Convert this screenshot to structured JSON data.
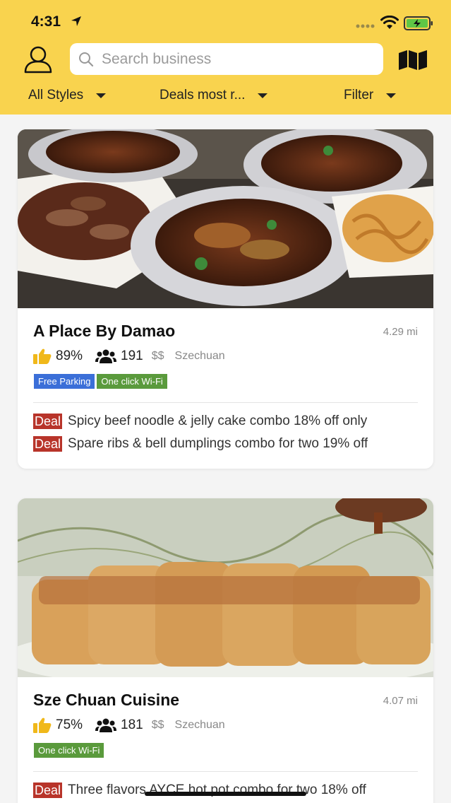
{
  "status_bar": {
    "time": "4:31"
  },
  "search": {
    "placeholder": "Search business",
    "value": ""
  },
  "filters": [
    {
      "label": "All Styles"
    },
    {
      "label": "Deals most r..."
    },
    {
      "label": "Filter"
    }
  ],
  "listings": [
    {
      "name": "A Place By Damao",
      "distance": "4.29 mi",
      "rating": "89%",
      "count": "191",
      "price": "$$",
      "cuisine": "Szechuan",
      "tags": [
        "Free Parking",
        "One click Wi-Fi"
      ],
      "deal_label": "Deal",
      "deals": [
        "Spicy beef noodle & jelly cake combo 18% off only",
        "Spare ribs & bell dumplings combo for two 19% off"
      ]
    },
    {
      "name": "Sze Chuan Cuisine",
      "distance": "4.07 mi",
      "rating": "75%",
      "count": "181",
      "price": "$$",
      "cuisine": "Szechuan",
      "tags": [
        "One click Wi-Fi"
      ],
      "deal_label": "Deal",
      "deals": [
        "Three flavors AYCE hot pot combo for two 18% off"
      ]
    }
  ],
  "colors": {
    "header": "#f9d34e",
    "deal_badge": "#b8342a",
    "tag_blue": "#3b6fd8",
    "tag_green": "#5a9a3c"
  },
  "icons": {
    "profile": "person-outline-icon",
    "search": "search-icon",
    "map": "map-icon",
    "rating": "thumbs-up-icon",
    "reviewers": "people-icon"
  }
}
